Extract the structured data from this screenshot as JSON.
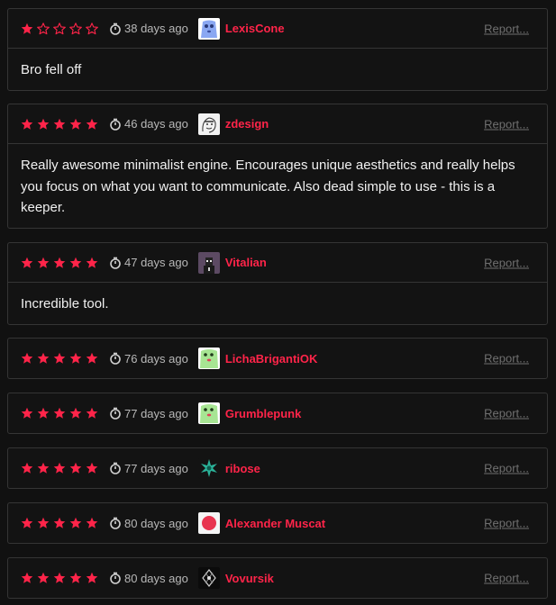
{
  "theme": {
    "star_color": "#ff2449",
    "username_color": "#ff2449",
    "report_color": "#6f6f6f"
  },
  "reviews": [
    {
      "rating": 1,
      "time": "38 days ago",
      "username": "LexisCone",
      "avatar": "blue-blob-avatar",
      "report": "Report...",
      "body": "Bro fell off"
    },
    {
      "rating": 5,
      "time": "46 days ago",
      "username": "zdesign",
      "avatar": "sketch-face-avatar",
      "report": "Report...",
      "body": "Really awesome minimalist engine. Encourages unique aesthetics and really helps you focus on what you want to communicate. Also dead simple to use - this is a keeper."
    },
    {
      "rating": 5,
      "time": "47 days ago",
      "username": "Vitalian",
      "avatar": "dark-figure-avatar",
      "report": "Report...",
      "body": "Incredible tool."
    },
    {
      "rating": 5,
      "time": "76 days ago",
      "username": "LichaBrigantiOK",
      "avatar": "green-blob-avatar",
      "report": "Report...",
      "body": ""
    },
    {
      "rating": 5,
      "time": "77 days ago",
      "username": "Grumblepunk",
      "avatar": "green-blob-avatar",
      "report": "Report...",
      "body": ""
    },
    {
      "rating": 5,
      "time": "77 days ago",
      "username": "ribose",
      "avatar": "teal-flower-avatar",
      "report": "Report...",
      "body": ""
    },
    {
      "rating": 5,
      "time": "80 days ago",
      "username": "Alexander Muscat",
      "avatar": "red-circle-avatar",
      "report": "Report...",
      "body": ""
    },
    {
      "rating": 5,
      "time": "80 days ago",
      "username": "Vovursik",
      "avatar": "dark-emblem-avatar",
      "report": "Report...",
      "body": ""
    }
  ]
}
